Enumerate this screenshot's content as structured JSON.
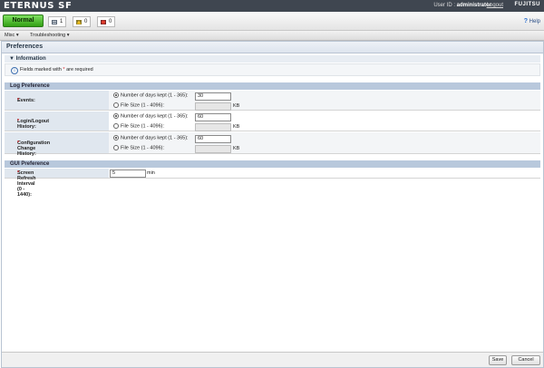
{
  "header": {
    "brand": "ETERNUS SF",
    "user_label": "User ID :",
    "user_name": "administrator",
    "logout": "Logout",
    "vendor": "FUJITSU"
  },
  "status": {
    "state": "Normal",
    "counters": [
      {
        "icon": "storage-icon",
        "value": "1"
      },
      {
        "icon": "warning-icon",
        "value": "0"
      },
      {
        "icon": "error-icon",
        "value": "0"
      }
    ],
    "help": "Help"
  },
  "menubar": {
    "items": [
      "Misc ▾",
      "Troubleshooting ▾"
    ]
  },
  "page": {
    "title": "Preferences",
    "info_header": "▼  Information",
    "info_text_before": "Fields marked with",
    "info_required_mark": "*",
    "info_text_after": "are required"
  },
  "log_preference": {
    "title": "Log Preference",
    "rows": [
      {
        "label": "Events:",
        "opt_days": "Number of days kept (1 - 365):",
        "days_value": "30",
        "opt_size": "File Size (1 - 4096):",
        "size_unit": "KB"
      },
      {
        "label": "Login/Logout History:",
        "opt_days": "Number of days kept (1 - 365):",
        "days_value": "60",
        "opt_size": "File Size (1 - 4096):",
        "size_unit": "KB"
      },
      {
        "label": "Configuration Change History:",
        "opt_days": "Number of days kept (1 - 365):",
        "days_value": "60",
        "opt_size": "File Size (1 - 4096):",
        "size_unit": "KB"
      }
    ],
    "required_mark": "*"
  },
  "gui_preference": {
    "title": "GUI Preference",
    "label": "Screen Refresh Interval (0 - 1440):",
    "value": "5",
    "unit": "min",
    "required_mark": "*"
  },
  "footer": {
    "save": "Save",
    "cancel": "Cancel"
  },
  "colors": {
    "topbar": "#3f4650",
    "status_green": "#33a014",
    "section_header": "#b8c8dc",
    "label_bg": "#e0e7ef",
    "required": "#d8242a"
  }
}
